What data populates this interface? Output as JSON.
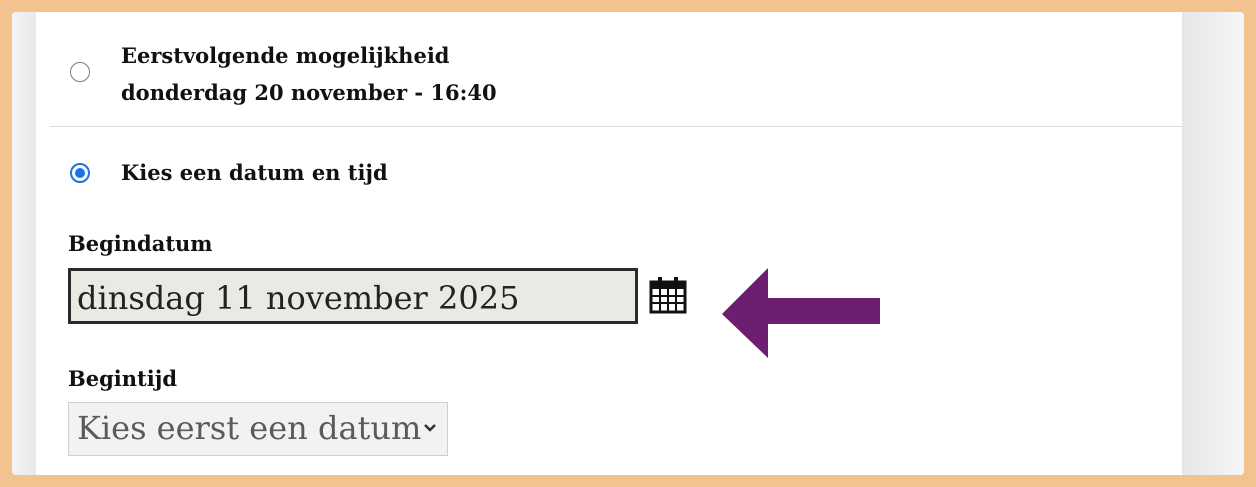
{
  "options": {
    "first_available": {
      "title": "Eerstvolgende mogelijkheid",
      "detail": "donderdag 20 november - 16:40",
      "selected": false
    },
    "choose_date": {
      "label": "Kies een datum en tijd",
      "selected": true
    }
  },
  "start_date": {
    "label": "Begindatum",
    "value": "dinsdag 11 november 2025"
  },
  "start_time": {
    "label": "Begintijd",
    "selected_value": "Kies eerst een datum"
  },
  "colors": {
    "frame": "#f2c38e",
    "radio_accent": "#1a73e8",
    "arrow": "#6b1f6e",
    "input_background": "#ebe9e3"
  },
  "icons": [
    "calendar-icon",
    "chevron-down-icon",
    "arrow-left-icon"
  ]
}
